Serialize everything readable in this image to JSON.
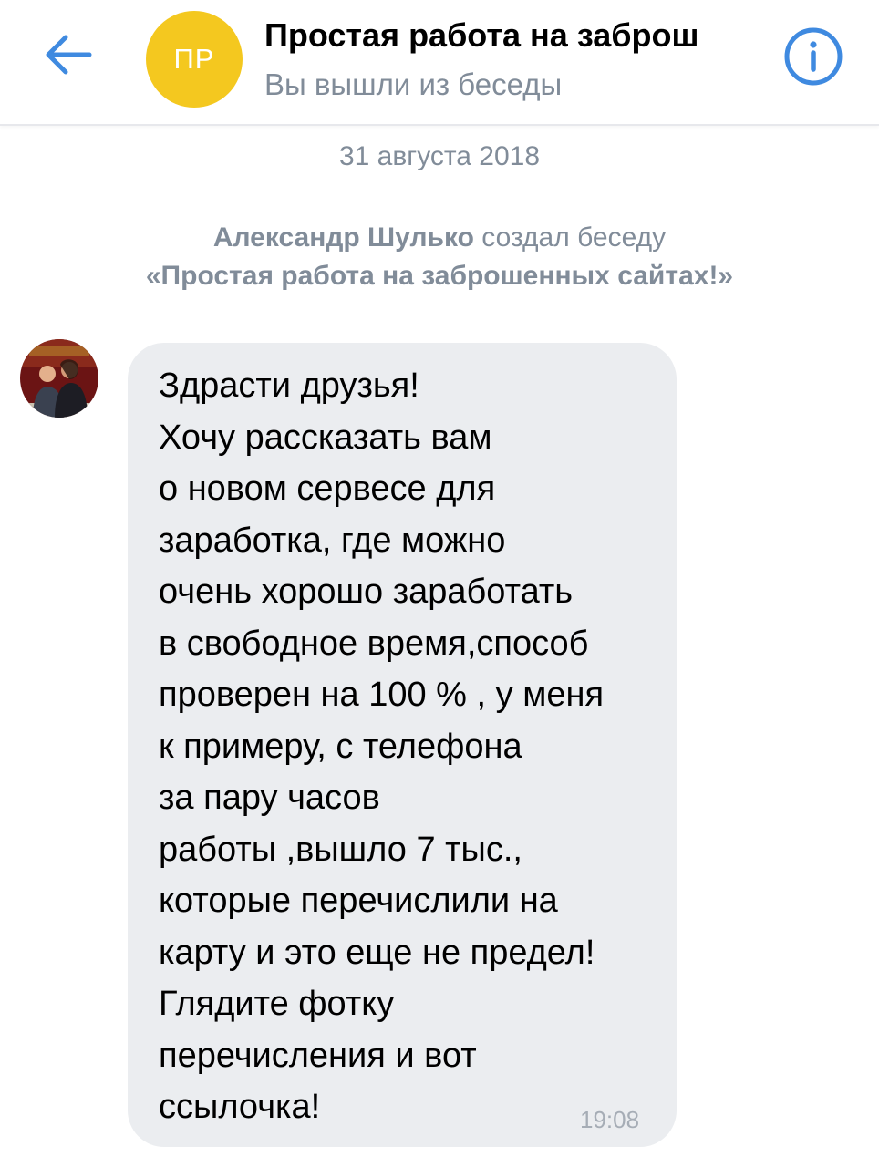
{
  "header": {
    "back_icon": "arrow-left-icon",
    "avatar_initials": "ПР",
    "title": "Простая работа на заброш",
    "subtitle": "Вы вышли из беседы",
    "info_icon": "info-icon",
    "accent_color": "#3f8ae0",
    "avatar_color": "#f4c81f"
  },
  "feed": {
    "date_separator": "31 августа 2018",
    "service_message": {
      "author": "Александр Шулько",
      "action": "создал беседу",
      "chat_name": "«Простая работа на заброшенных сайтах!»"
    },
    "messages": [
      {
        "avatar_icon": "user-photo-avatar",
        "text": "Здрасти друзья!\nХочу рассказать вам\nо новом сервесе для\nзаработка, где можно\nочень хорошо заработать\nв свободное время,способ\nпроверен на 100 % , у меня\nк примеру, с телефона\nза пару часов\nработы ,вышло 7 тыс.,\nкоторые перечислили на\nкарту и это еще не предел!\nГлядите фотку\nперечисления и вот\nссылочка!",
        "time": "19:08",
        "bubble_color": "#ebedf0"
      }
    ]
  }
}
